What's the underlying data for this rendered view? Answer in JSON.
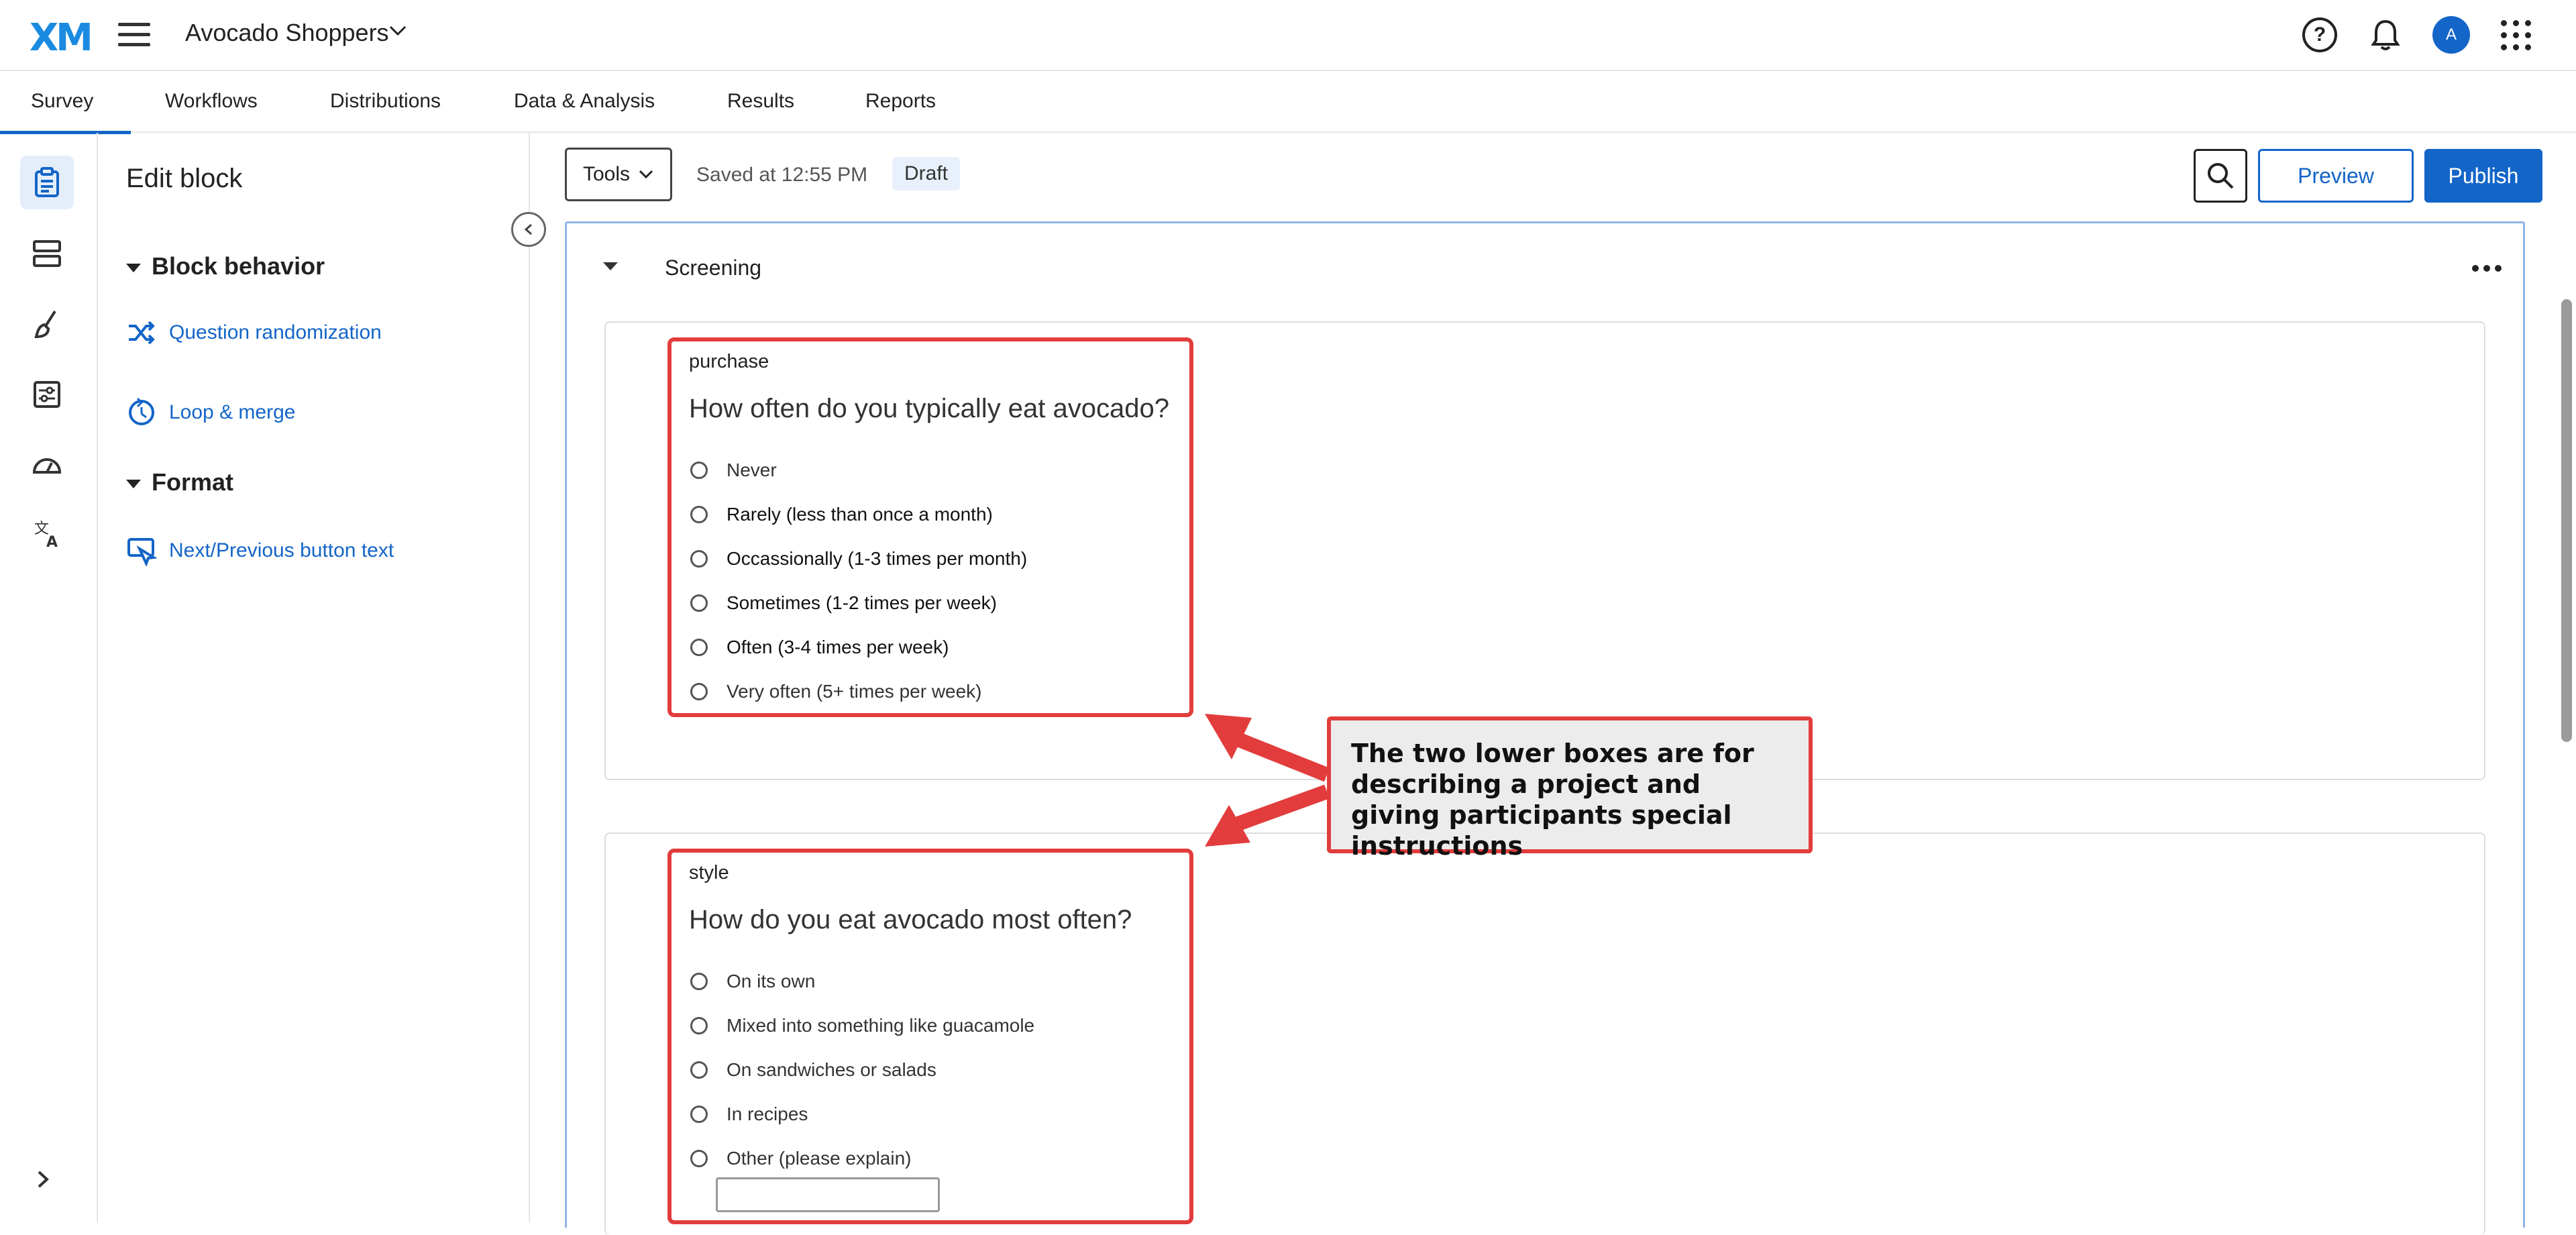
{
  "app": {
    "logo": "XM",
    "project_name": "Avocado Shoppers",
    "avatar_initial": "A"
  },
  "tabs": [
    "Survey",
    "Workflows",
    "Distributions",
    "Data & Analysis",
    "Results",
    "Reports"
  ],
  "active_tab": "Survey",
  "side_panel": {
    "title": "Edit block",
    "sections": [
      {
        "heading": "Block behavior",
        "links": [
          "Question randomization",
          "Loop & merge"
        ]
      },
      {
        "heading": "Format",
        "links": [
          "Next/Previous button text"
        ]
      }
    ]
  },
  "toolbar": {
    "tools_label": "Tools",
    "saved_text": "Saved at 12:55 PM",
    "status_badge": "Draft",
    "preview_label": "Preview",
    "publish_label": "Publish"
  },
  "block": {
    "title": "Screening",
    "questions": [
      {
        "id": "purchase",
        "text": "How often do you typically eat avocado?",
        "options": [
          "Never",
          "Rarely (less than once a month)",
          "Occassionally (1-3 times per month)",
          "Sometimes (1-2 times per week)",
          "Often (3-4 times per week)",
          "Very often (5+ times per week)"
        ]
      },
      {
        "id": "style",
        "text": "How do you eat avocado most often?",
        "options": [
          "On its own",
          "Mixed into something like guacamole",
          "On sandwiches or salads",
          "In recipes",
          "Other (please explain)"
        ]
      }
    ]
  },
  "annotation": {
    "text": "The two lower boxes are for describing a project and giving participants special instructions",
    "color": "#e23c3c"
  },
  "colors": {
    "accent": "#1365c8",
    "logo": "#1a8be0",
    "highlight": "#e23c3c"
  }
}
